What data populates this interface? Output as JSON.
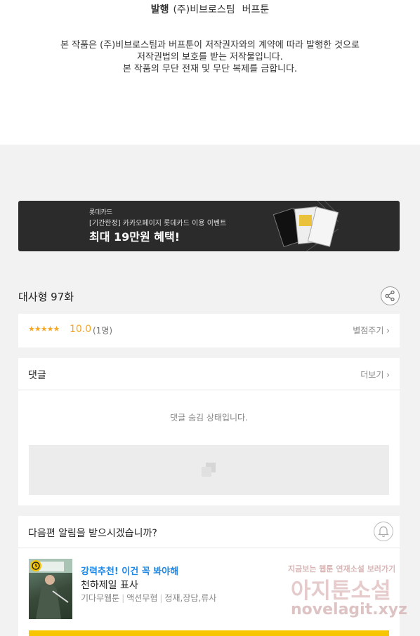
{
  "publisher": {
    "label": "발행",
    "company": "(주)비브로스팀",
    "platform": "버프툰"
  },
  "copyright": {
    "line1": "본 작품은 (주)비브로스팀과 버프툰이 저작권자와의 계약에 따라 발행한 것으로",
    "line2": "저작권법의 보호를 받는 저작물입니다.",
    "line3": "본 작품의 무단 전재 및 무단 복제를 금합니다."
  },
  "banner": {
    "brand": "롯데카드",
    "desc": "[기간한정] 카카오페이지 롯데카드 이용 이벤트",
    "headline": "최대 19만원 혜택!"
  },
  "episode": {
    "title": "대사형 97화",
    "share_icon": "share-icon"
  },
  "rating": {
    "stars": "★★★★★",
    "score": "10.0",
    "count": "(1명)",
    "give_label": "별점주기 ›"
  },
  "comments": {
    "label": "댓글",
    "more": "더보기 ›",
    "hidden_msg": "댓글 숨김 상태입니다."
  },
  "notify": {
    "question": "다음편 알림을 받으시겠습니까?",
    "bell_icon": "bell-icon",
    "rec_tag": "강력추천! 이건 꼭 봐야해",
    "rec_name": "천하제일 표사",
    "rec_meta": [
      "기다무웹툰",
      "액션무협",
      "정재,장담,류사"
    ]
  },
  "watermark": {
    "line1": "지금보는 웹툰 연재소설 보러가기",
    "line2": "아지툰소설",
    "line3": "novelagit.xyz"
  },
  "colors": {
    "accent": "#f5a623",
    "link": "#1e88e5",
    "cta": "#f7c600"
  }
}
